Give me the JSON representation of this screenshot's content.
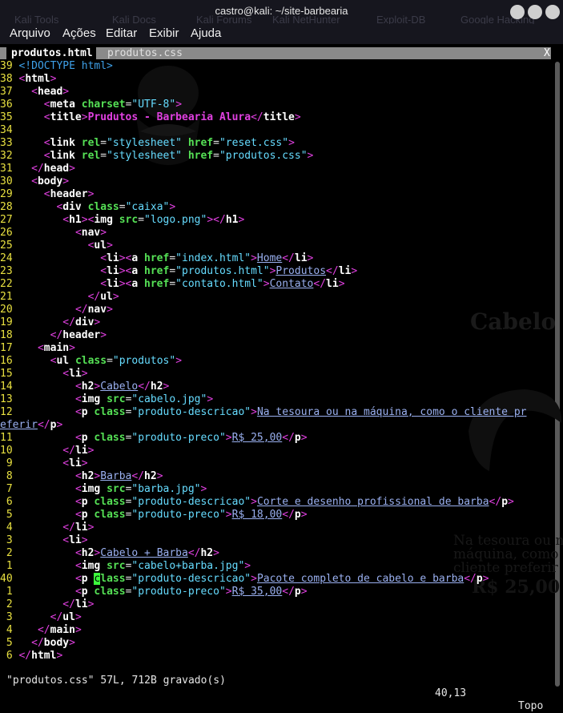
{
  "window": {
    "title": "castro@kali: ~/site-barbearia",
    "ghost_bookmarks": [
      "Kali Tools",
      "Kali Docs",
      "Kali Forums",
      "Kali NetHunter",
      "Exploit-DB",
      "Google Hacking"
    ]
  },
  "menu": [
    "Arquivo",
    "Ações",
    "Editar",
    "Exibir",
    "Ajuda"
  ],
  "tabs": {
    "active": "produtos.html",
    "inactive": "produtos.css",
    "close": "X"
  },
  "ghost_preview": {
    "heading": "Cabelo",
    "description": "Na tesoura ou na máquina, como o cliente preferir",
    "price": "R$ 25,00"
  },
  "status": {
    "message": "\"produtos.css\" 57L, 712B gravado(s)",
    "position": "40,13",
    "scroll": "Topo"
  },
  "colors": {
    "tag": "#e040e0",
    "attribute": "#55e055",
    "value": "#66dcff",
    "line_number": "#e8e040",
    "cursor": "#3cff3c"
  },
  "lines": [
    {
      "n": "39",
      "segs": [
        [
          "cm",
          "<!DOCTYPE html>"
        ]
      ]
    },
    {
      "n": "38",
      "segs": [
        [
          "tg",
          "<"
        ],
        [
          "nm",
          "html"
        ],
        [
          "tg",
          ">"
        ]
      ]
    },
    {
      "n": "37",
      "segs": [
        [
          "",
          "  "
        ],
        [
          "tg",
          "<"
        ],
        [
          "nm",
          "head"
        ],
        [
          "tg",
          ">"
        ]
      ]
    },
    {
      "n": "36",
      "segs": [
        [
          "",
          "    "
        ],
        [
          "tg",
          "<"
        ],
        [
          "nm",
          "meta "
        ],
        [
          "at",
          "charset"
        ],
        [
          "",
          "="
        ],
        [
          "vl",
          "\"UTF-8\""
        ],
        [
          "tg",
          ">"
        ]
      ]
    },
    {
      "n": "35",
      "segs": [
        [
          "",
          "    "
        ],
        [
          "tg",
          "<"
        ],
        [
          "nm",
          "title"
        ],
        [
          "tg",
          ">"
        ],
        [
          "tt",
          "Prudutos - Barbearia Alura"
        ],
        [
          "tg",
          "</"
        ],
        [
          "nm",
          "title"
        ],
        [
          "tg",
          ">"
        ]
      ]
    },
    {
      "n": "34",
      "segs": []
    },
    {
      "n": "33",
      "segs": [
        [
          "",
          "    "
        ],
        [
          "tg",
          "<"
        ],
        [
          "nm",
          "link "
        ],
        [
          "at",
          "rel"
        ],
        [
          "",
          "="
        ],
        [
          "vl",
          "\"stylesheet\""
        ],
        [
          "at",
          " href"
        ],
        [
          "",
          "="
        ],
        [
          "vl",
          "\"reset.css\""
        ],
        [
          "tg",
          ">"
        ]
      ]
    },
    {
      "n": "32",
      "segs": [
        [
          "",
          "    "
        ],
        [
          "tg",
          "<"
        ],
        [
          "nm",
          "link "
        ],
        [
          "at",
          "rel"
        ],
        [
          "",
          "="
        ],
        [
          "vl",
          "\"stylesheet\""
        ],
        [
          "at",
          " href"
        ],
        [
          "",
          "="
        ],
        [
          "vl",
          "\"produtos.css\""
        ],
        [
          "tg",
          ">"
        ]
      ]
    },
    {
      "n": "31",
      "segs": [
        [
          "",
          "  "
        ],
        [
          "tg",
          "</"
        ],
        [
          "nm",
          "head"
        ],
        [
          "tg",
          ">"
        ]
      ]
    },
    {
      "n": "30",
      "segs": [
        [
          "",
          "  "
        ],
        [
          "tg",
          "<"
        ],
        [
          "nm",
          "body"
        ],
        [
          "tg",
          ">"
        ]
      ]
    },
    {
      "n": "29",
      "segs": [
        [
          "",
          "    "
        ],
        [
          "tg",
          "<"
        ],
        [
          "nm",
          "header"
        ],
        [
          "tg",
          ">"
        ]
      ]
    },
    {
      "n": "28",
      "segs": [
        [
          "",
          "      "
        ],
        [
          "tg",
          "<"
        ],
        [
          "nm",
          "div "
        ],
        [
          "at",
          "class"
        ],
        [
          "",
          "="
        ],
        [
          "vl",
          "\"caixa\""
        ],
        [
          "tg",
          ">"
        ]
      ]
    },
    {
      "n": "27",
      "segs": [
        [
          "",
          "       "
        ],
        [
          "tg",
          "<"
        ],
        [
          "nm",
          "h1"
        ],
        [
          "tg",
          "><"
        ],
        [
          "nm",
          "img "
        ],
        [
          "at",
          "src"
        ],
        [
          "",
          "="
        ],
        [
          "vl",
          "\"logo.png\""
        ],
        [
          "tg",
          "></"
        ],
        [
          "nm",
          "h1"
        ],
        [
          "tg",
          ">"
        ]
      ]
    },
    {
      "n": "26",
      "segs": [
        [
          "",
          "         "
        ],
        [
          "tg",
          "<"
        ],
        [
          "nm",
          "nav"
        ],
        [
          "tg",
          ">"
        ]
      ]
    },
    {
      "n": "25",
      "segs": [
        [
          "",
          "           "
        ],
        [
          "tg",
          "<"
        ],
        [
          "nm",
          "ul"
        ],
        [
          "tg",
          ">"
        ]
      ]
    },
    {
      "n": "24",
      "segs": [
        [
          "",
          "             "
        ],
        [
          "tg",
          "<"
        ],
        [
          "nm",
          "li"
        ],
        [
          "tg",
          "><"
        ],
        [
          "nm",
          "a "
        ],
        [
          "at",
          "href"
        ],
        [
          "",
          "="
        ],
        [
          "vl",
          "\"index.html\""
        ],
        [
          "tg",
          ">"
        ],
        [
          "tx",
          "Home"
        ],
        [
          "tg",
          "</"
        ],
        [
          "nm",
          "li"
        ],
        [
          "tg",
          ">"
        ]
      ]
    },
    {
      "n": "23",
      "segs": [
        [
          "",
          "             "
        ],
        [
          "tg",
          "<"
        ],
        [
          "nm",
          "li"
        ],
        [
          "tg",
          "><"
        ],
        [
          "nm",
          "a "
        ],
        [
          "at",
          "href"
        ],
        [
          "",
          "="
        ],
        [
          "vl",
          "\"produtos.html\""
        ],
        [
          "tg",
          ">"
        ],
        [
          "tx",
          "Produtos"
        ],
        [
          "tg",
          "</"
        ],
        [
          "nm",
          "li"
        ],
        [
          "tg",
          ">"
        ]
      ]
    },
    {
      "n": "22",
      "segs": [
        [
          "",
          "             "
        ],
        [
          "tg",
          "<"
        ],
        [
          "nm",
          "li"
        ],
        [
          "tg",
          "><"
        ],
        [
          "nm",
          "a "
        ],
        [
          "at",
          "href"
        ],
        [
          "",
          "="
        ],
        [
          "vl",
          "\"contato.html\""
        ],
        [
          "tg",
          ">"
        ],
        [
          "tx",
          "Contato"
        ],
        [
          "tg",
          "</"
        ],
        [
          "nm",
          "li"
        ],
        [
          "tg",
          ">"
        ]
      ]
    },
    {
      "n": "21",
      "segs": [
        [
          "",
          "           "
        ],
        [
          "tg",
          "</"
        ],
        [
          "nm",
          "ul"
        ],
        [
          "tg",
          ">"
        ]
      ]
    },
    {
      "n": "20",
      "segs": [
        [
          "",
          "         "
        ],
        [
          "tg",
          "</"
        ],
        [
          "nm",
          "nav"
        ],
        [
          "tg",
          ">"
        ]
      ]
    },
    {
      "n": "19",
      "segs": [
        [
          "",
          "       "
        ],
        [
          "tg",
          "</"
        ],
        [
          "nm",
          "div"
        ],
        [
          "tg",
          ">"
        ]
      ]
    },
    {
      "n": "18",
      "segs": [
        [
          "",
          "     "
        ],
        [
          "tg",
          "</"
        ],
        [
          "nm",
          "header"
        ],
        [
          "tg",
          ">"
        ]
      ]
    },
    {
      "n": "17",
      "segs": [
        [
          "",
          "   "
        ],
        [
          "tg",
          "<"
        ],
        [
          "nm",
          "main"
        ],
        [
          "tg",
          ">"
        ]
      ]
    },
    {
      "n": "16",
      "segs": [
        [
          "",
          "     "
        ],
        [
          "tg",
          "<"
        ],
        [
          "nm",
          "ul "
        ],
        [
          "at",
          "class"
        ],
        [
          "",
          "="
        ],
        [
          "vl",
          "\"produtos\""
        ],
        [
          "tg",
          ">"
        ]
      ]
    },
    {
      "n": "15",
      "segs": [
        [
          "",
          "       "
        ],
        [
          "tg",
          "<"
        ],
        [
          "nm",
          "li"
        ],
        [
          "tg",
          ">"
        ]
      ]
    },
    {
      "n": "14",
      "segs": [
        [
          "",
          "         "
        ],
        [
          "tg",
          "<"
        ],
        [
          "nm",
          "h2"
        ],
        [
          "tg",
          ">"
        ],
        [
          "tx",
          "Cabelo"
        ],
        [
          "tg",
          "</"
        ],
        [
          "nm",
          "h2"
        ],
        [
          "tg",
          ">"
        ]
      ]
    },
    {
      "n": "13",
      "segs": [
        [
          "",
          "         "
        ],
        [
          "tg",
          "<"
        ],
        [
          "nm",
          "img "
        ],
        [
          "at",
          "src"
        ],
        [
          "",
          "="
        ],
        [
          "vl",
          "\"cabelo.jpg\""
        ],
        [
          "tg",
          ">"
        ]
      ]
    },
    {
      "n": "12",
      "segs": [
        [
          "",
          "         "
        ],
        [
          "tg",
          "<"
        ],
        [
          "nm",
          "p "
        ],
        [
          "at",
          "class"
        ],
        [
          "",
          "="
        ],
        [
          "vl",
          "\"produto-descricao\""
        ],
        [
          "tg",
          ">"
        ],
        [
          "tx",
          "Na tesoura ou na máquina, como o cliente pr"
        ]
      ]
    },
    {
      "n": "",
      "segs": [
        [
          "tx",
          "eferir"
        ],
        [
          "tg",
          "</"
        ],
        [
          "nm",
          "p"
        ],
        [
          "tg",
          ">"
        ]
      ]
    },
    {
      "n": "11",
      "segs": [
        [
          "",
          "         "
        ],
        [
          "tg",
          "<"
        ],
        [
          "nm",
          "p "
        ],
        [
          "at",
          "class"
        ],
        [
          "",
          "="
        ],
        [
          "vl",
          "\"produto-preco\""
        ],
        [
          "tg",
          ">"
        ],
        [
          "tx",
          "R$ 25,00"
        ],
        [
          "tg",
          "</"
        ],
        [
          "nm",
          "p"
        ],
        [
          "tg",
          ">"
        ]
      ]
    },
    {
      "n": "10",
      "segs": [
        [
          "",
          "       "
        ],
        [
          "tg",
          "</"
        ],
        [
          "nm",
          "li"
        ],
        [
          "tg",
          ">"
        ]
      ]
    },
    {
      "n": "9",
      "segs": [
        [
          "",
          "       "
        ],
        [
          "tg",
          "<"
        ],
        [
          "nm",
          "li"
        ],
        [
          "tg",
          ">"
        ]
      ]
    },
    {
      "n": "8",
      "segs": [
        [
          "",
          "         "
        ],
        [
          "tg",
          "<"
        ],
        [
          "nm",
          "h2"
        ],
        [
          "tg",
          ">"
        ],
        [
          "tx",
          "Barba"
        ],
        [
          "tg",
          "</"
        ],
        [
          "nm",
          "h2"
        ],
        [
          "tg",
          ">"
        ]
      ]
    },
    {
      "n": "7",
      "segs": [
        [
          "",
          "         "
        ],
        [
          "tg",
          "<"
        ],
        [
          "nm",
          "img "
        ],
        [
          "at",
          "src"
        ],
        [
          "",
          "="
        ],
        [
          "vl",
          "\"barba.jpg\""
        ],
        [
          "tg",
          ">"
        ]
      ]
    },
    {
      "n": "6",
      "segs": [
        [
          "",
          "         "
        ],
        [
          "tg",
          "<"
        ],
        [
          "nm",
          "p "
        ],
        [
          "at",
          "class"
        ],
        [
          "",
          "="
        ],
        [
          "vl",
          "\"produto-descricao\""
        ],
        [
          "tg",
          ">"
        ],
        [
          "tx",
          "Corte e desenho profissional de barba"
        ],
        [
          "tg",
          "</"
        ],
        [
          "nm",
          "p"
        ],
        [
          "tg",
          ">"
        ]
      ]
    },
    {
      "n": "5",
      "segs": [
        [
          "",
          "         "
        ],
        [
          "tg",
          "<"
        ],
        [
          "nm",
          "p "
        ],
        [
          "at",
          "class"
        ],
        [
          "",
          "="
        ],
        [
          "vl",
          "\"produto-preco\""
        ],
        [
          "tg",
          ">"
        ],
        [
          "tx",
          "R$ 18,00"
        ],
        [
          "tg",
          "</"
        ],
        [
          "nm",
          "p"
        ],
        [
          "tg",
          ">"
        ]
      ]
    },
    {
      "n": "4",
      "segs": [
        [
          "",
          "       "
        ],
        [
          "tg",
          "</"
        ],
        [
          "nm",
          "li"
        ],
        [
          "tg",
          ">"
        ]
      ]
    },
    {
      "n": "3",
      "segs": [
        [
          "",
          "       "
        ],
        [
          "tg",
          "<"
        ],
        [
          "nm",
          "li"
        ],
        [
          "tg",
          ">"
        ]
      ]
    },
    {
      "n": "2",
      "segs": [
        [
          "",
          "         "
        ],
        [
          "tg",
          "<"
        ],
        [
          "nm",
          "h2"
        ],
        [
          "tg",
          ">"
        ],
        [
          "tx",
          "Cabelo + Barba"
        ],
        [
          "tg",
          "</"
        ],
        [
          "nm",
          "h2"
        ],
        [
          "tg",
          ">"
        ]
      ]
    },
    {
      "n": "1",
      "segs": [
        [
          "",
          "         "
        ],
        [
          "tg",
          "<"
        ],
        [
          "nm",
          "img "
        ],
        [
          "at",
          "src"
        ],
        [
          "",
          "="
        ],
        [
          "vl",
          "\"cabelo+barba.jpg\""
        ],
        [
          "tg",
          ">"
        ]
      ]
    },
    {
      "n": "40",
      "current": true,
      "segs": [
        [
          "",
          "         "
        ],
        [
          "tg",
          "<"
        ],
        [
          "nm",
          "p "
        ],
        [
          "cur",
          "c"
        ],
        [
          "at",
          "lass"
        ],
        [
          "",
          "="
        ],
        [
          "vl",
          "\"produto-descricao\""
        ],
        [
          "tg",
          ">"
        ],
        [
          "tx",
          "Pacote completo de cabelo e barba"
        ],
        [
          "tg",
          "</"
        ],
        [
          "nm",
          "p"
        ],
        [
          "tg",
          ">"
        ]
      ]
    },
    {
      "n": "1",
      "segs": [
        [
          "",
          "         "
        ],
        [
          "tg",
          "<"
        ],
        [
          "nm",
          "p "
        ],
        [
          "at",
          "class"
        ],
        [
          "",
          "="
        ],
        [
          "vl",
          "\"produto-preco\""
        ],
        [
          "tg",
          ">"
        ],
        [
          "tx",
          "R$ 35,00"
        ],
        [
          "tg",
          "</"
        ],
        [
          "nm",
          "p"
        ],
        [
          "tg",
          ">"
        ]
      ]
    },
    {
      "n": "2",
      "segs": [
        [
          "",
          "       "
        ],
        [
          "tg",
          "</"
        ],
        [
          "nm",
          "li"
        ],
        [
          "tg",
          ">"
        ]
      ]
    },
    {
      "n": "3",
      "segs": [
        [
          "",
          "     "
        ],
        [
          "tg",
          "</"
        ],
        [
          "nm",
          "ul"
        ],
        [
          "tg",
          ">"
        ]
      ]
    },
    {
      "n": "4",
      "segs": [
        [
          "",
          "   "
        ],
        [
          "tg",
          "</"
        ],
        [
          "nm",
          "main"
        ],
        [
          "tg",
          ">"
        ]
      ]
    },
    {
      "n": "5",
      "segs": [
        [
          "",
          "  "
        ],
        [
          "tg",
          "</"
        ],
        [
          "nm",
          "body"
        ],
        [
          "tg",
          ">"
        ]
      ]
    },
    {
      "n": "6",
      "segs": [
        [
          "tg",
          "</"
        ],
        [
          "nm",
          "html"
        ],
        [
          "tg",
          ">"
        ]
      ]
    }
  ]
}
